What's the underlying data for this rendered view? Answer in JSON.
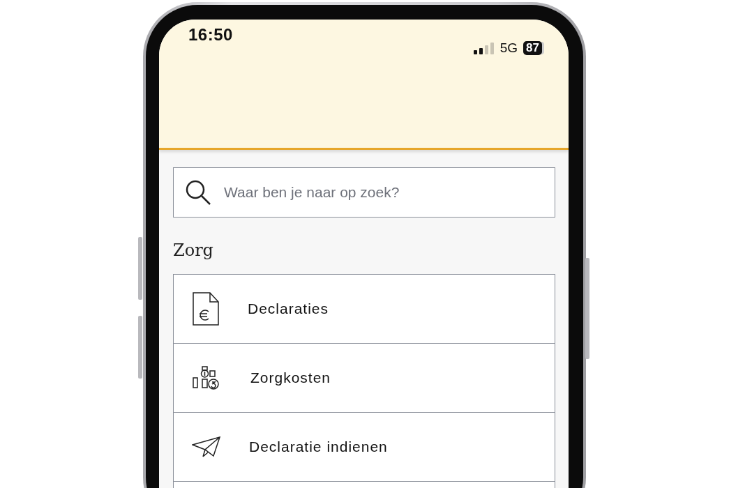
{
  "status_bar": {
    "time": "16:50",
    "network": "5G",
    "battery": "87"
  },
  "search": {
    "placeholder": "Waar ben je naar op zoek?"
  },
  "section": {
    "title": "Zorg",
    "items": [
      {
        "label": "Declaraties",
        "kind": "document"
      },
      {
        "label": "Zorgkosten",
        "kind": "coins"
      },
      {
        "label": "Declaratie indienen",
        "kind": "send"
      }
    ]
  }
}
